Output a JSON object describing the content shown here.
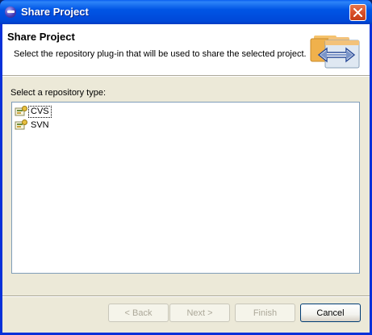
{
  "window": {
    "title": "Share Project"
  },
  "banner": {
    "title": "Share Project",
    "message": "Select the repository plug-in that will be used to share the selected project."
  },
  "repository_list": {
    "label": "Select a repository type:",
    "items": [
      {
        "label": "CVS",
        "icon": "cvs-repository-icon",
        "selected": true
      },
      {
        "label": "SVN",
        "icon": "svn-repository-icon",
        "selected": false
      }
    ]
  },
  "buttons": {
    "back": {
      "label": "< Back",
      "enabled": false
    },
    "next": {
      "label": "Next >",
      "enabled": false
    },
    "finish": {
      "label": "Finish",
      "enabled": false
    },
    "cancel": {
      "label": "Cancel",
      "enabled": true
    }
  },
  "colors": {
    "titlebar": "#0055e5",
    "dialog_background": "#ece9d8",
    "banner_background": "#ffffff",
    "close_button": "#d9502a"
  }
}
